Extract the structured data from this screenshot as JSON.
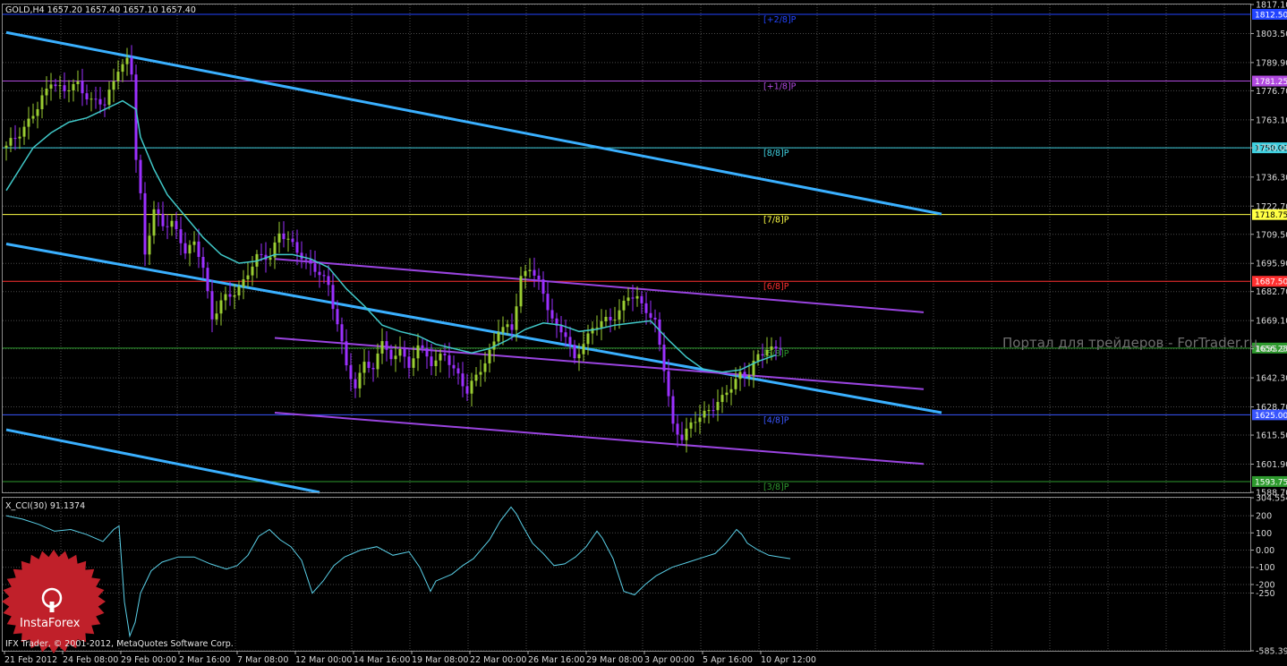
{
  "header": {
    "symbol_line": "GOLD,H4  1657.20 1657.40 1657.10 1657.40",
    "indicator_line": "X_CCI(30) 91.1374",
    "footer_text": "IFX Trader, © 2001-2012, MetaQuotes Software Corp.",
    "watermark": "Портал для трейдеров - ForTrader.ru",
    "logo_text": "InstaForex"
  },
  "colors": {
    "background": "#000000",
    "grid": "#4a4a4a",
    "bull_candle": "#9acd32",
    "bear_candle": "#9b30ff",
    "moving_average": "#40c8c8",
    "trend_channel": "#3ab0ff",
    "inner_channel": "#9a44e0",
    "cci_line": "#5ad0e8",
    "logo": "#c0202a"
  },
  "chart_data": [
    {
      "type": "candlestick",
      "symbol": "GOLD",
      "timeframe": "H4",
      "ylim": [
        1588.7,
        1817.1
      ],
      "y_ticks": [
        "1817.10",
        "1803.50",
        "1789.90",
        "1776.70",
        "1763.10",
        "1750.00",
        "1736.30",
        "1722.70",
        "1709.50",
        "1695.90",
        "1682.70",
        "1669.10",
        "1655.90",
        "1642.30",
        "1628.70",
        "1615.50",
        "1601.90",
        "1588.70"
      ],
      "x_labels": [
        "21 Feb 2012",
        "24 Feb 08:00",
        "29 Feb 00:00",
        "2 Mar 16:00",
        "7 Mar 08:00",
        "12 Mar 00:00",
        "14 Mar 16:00",
        "19 Mar 08:00",
        "22 Mar 00:00",
        "26 Mar 16:00",
        "29 Mar 08:00",
        "3 Apr 00:00",
        "5 Apr 16:00",
        "10 Apr 12:00"
      ],
      "price_path": [
        [
          0,
          1750
        ],
        [
          4,
          1760
        ],
        [
          7,
          1768
        ],
        [
          10,
          1782
        ],
        [
          13,
          1776
        ],
        [
          16,
          1780
        ],
        [
          19,
          1772
        ],
        [
          22,
          1770
        ],
        [
          25,
          1788
        ],
        [
          27,
          1790
        ],
        [
          28,
          1784
        ],
        [
          29,
          1745
        ],
        [
          30,
          1728
        ],
        [
          31,
          1700
        ],
        [
          33,
          1722
        ],
        [
          35,
          1712
        ],
        [
          37,
          1716
        ],
        [
          40,
          1702
        ],
        [
          42,
          1704
        ],
        [
          44,
          1695
        ],
        [
          46,
          1670
        ],
        [
          48,
          1678
        ],
        [
          50,
          1680
        ],
        [
          53,
          1688
        ],
        [
          56,
          1698
        ],
        [
          59,
          1700
        ],
        [
          61,
          1710
        ],
        [
          63,
          1706
        ],
        [
          66,
          1700
        ],
        [
          68,
          1695
        ],
        [
          70,
          1690
        ],
        [
          72,
          1686
        ],
        [
          74,
          1668
        ],
        [
          76,
          1648
        ],
        [
          78,
          1636
        ],
        [
          80,
          1652
        ],
        [
          82,
          1645
        ],
        [
          84,
          1660
        ],
        [
          86,
          1650
        ],
        [
          88,
          1658
        ],
        [
          90,
          1645
        ],
        [
          92,
          1658
        ],
        [
          95,
          1650
        ],
        [
          98,
          1652
        ],
        [
          101,
          1644
        ],
        [
          103,
          1636
        ],
        [
          105,
          1642
        ],
        [
          107,
          1650
        ],
        [
          110,
          1665
        ],
        [
          113,
          1665
        ],
        [
          115,
          1690
        ],
        [
          117,
          1694
        ],
        [
          119,
          1686
        ],
        [
          121,
          1676
        ],
        [
          123,
          1666
        ],
        [
          125,
          1662
        ],
        [
          127,
          1650
        ],
        [
          129,
          1660
        ],
        [
          131,
          1665
        ],
        [
          133,
          1668
        ],
        [
          135,
          1670
        ],
        [
          137,
          1674
        ],
        [
          139,
          1680
        ],
        [
          141,
          1679
        ],
        [
          143,
          1675
        ],
        [
          145,
          1668
        ],
        [
          147,
          1646
        ],
        [
          149,
          1620
        ],
        [
          151,
          1615
        ],
        [
          154,
          1622
        ],
        [
          157,
          1628
        ],
        [
          160,
          1632
        ],
        [
          162,
          1638
        ],
        [
          164,
          1645
        ],
        [
          166,
          1644
        ],
        [
          168,
          1652
        ],
        [
          170,
          1656
        ],
        [
          172,
          1657
        ],
        [
          173,
          1657
        ]
      ],
      "moving_average": [
        [
          0,
          1730
        ],
        [
          3,
          1740
        ],
        [
          6,
          1750
        ],
        [
          10,
          1757
        ],
        [
          14,
          1762
        ],
        [
          18,
          1764
        ],
        [
          22,
          1768
        ],
        [
          26,
          1772
        ],
        [
          29,
          1768
        ],
        [
          30,
          1755
        ],
        [
          33,
          1740
        ],
        [
          36,
          1728
        ],
        [
          40,
          1718
        ],
        [
          44,
          1708
        ],
        [
          48,
          1700
        ],
        [
          52,
          1696
        ],
        [
          56,
          1697
        ],
        [
          60,
          1700
        ],
        [
          64,
          1700
        ],
        [
          68,
          1698
        ],
        [
          72,
          1694
        ],
        [
          76,
          1684
        ],
        [
          80,
          1676
        ],
        [
          84,
          1667
        ],
        [
          88,
          1664
        ],
        [
          92,
          1662
        ],
        [
          96,
          1658
        ],
        [
          100,
          1656
        ],
        [
          104,
          1654
        ],
        [
          108,
          1656
        ],
        [
          112,
          1660
        ],
        [
          116,
          1665
        ],
        [
          120,
          1668
        ],
        [
          124,
          1667
        ],
        [
          128,
          1664
        ],
        [
          132,
          1665
        ],
        [
          136,
          1667
        ],
        [
          140,
          1668
        ],
        [
          144,
          1669
        ],
        [
          148,
          1660
        ],
        [
          152,
          1652
        ],
        [
          156,
          1646
        ],
        [
          160,
          1645
        ],
        [
          164,
          1646
        ],
        [
          168,
          1650
        ],
        [
          172,
          1653
        ]
      ],
      "levels": [
        {
          "label": "[+2/8]P",
          "price_tag": "1812.50",
          "value": 1812.5,
          "color": "#2244ff"
        },
        {
          "label": "[+1/8]P",
          "price_tag": "1781.25",
          "value": 1781.25,
          "color": "#b14ae0"
        },
        {
          "label": "[8/8]P",
          "price_tag": "1750.00",
          "value": 1750.0,
          "color": "#40d0e0"
        },
        {
          "label": "[7/8]P",
          "price_tag": "1718.75",
          "value": 1718.75,
          "color": "#ffff44"
        },
        {
          "label": "[6/8]P",
          "price_tag": "1687.50",
          "value": 1687.5,
          "color": "#ff3030"
        },
        {
          "label": "[5/8]P",
          "price_tag": "1656.25",
          "value": 1656.25,
          "color": "#2e9a2e"
        },
        {
          "label": "[4/8]P",
          "price_tag": "1625.00",
          "value": 1625.0,
          "color": "#3a56ff"
        },
        {
          "label": "[3/8]P",
          "price_tag": "1593.75",
          "value": 1593.75,
          "color": "#2e9a2e"
        }
      ],
      "trend_lines": [
        {
          "kind": "channel",
          "from": [
            0,
            1804
          ],
          "to": [
            209,
            1719
          ]
        },
        {
          "kind": "channel",
          "from": [
            0,
            1705
          ],
          "to": [
            209,
            1626
          ]
        },
        {
          "kind": "channel",
          "from": [
            0,
            1618
          ],
          "to": [
            70,
            1588.7
          ]
        },
        {
          "kind": "inner",
          "from": [
            60,
            1698
          ],
          "to": [
            205,
            1673
          ]
        },
        {
          "kind": "inner",
          "from": [
            60,
            1661
          ],
          "to": [
            205,
            1637
          ]
        },
        {
          "kind": "inner",
          "from": [
            60,
            1626
          ],
          "to": [
            205,
            1602
          ]
        }
      ]
    },
    {
      "type": "line",
      "name": "X_CCI(30)",
      "ylim": [
        -585.3956,
        304.5542
      ],
      "y_ticks": [
        "304.5542",
        "200",
        "100",
        "0.00",
        "-100",
        "-200",
        "-250",
        "-585.3956"
      ],
      "y_values": [
        304.5542,
        200,
        100,
        0,
        -100,
        -200,
        -250,
        -585.3956
      ],
      "points": [
        [
          0,
          200
        ],
        [
          3,
          180
        ],
        [
          6,
          150
        ],
        [
          9,
          110
        ],
        [
          12,
          120
        ],
        [
          15,
          90
        ],
        [
          18,
          50
        ],
        [
          20,
          120
        ],
        [
          21,
          140
        ],
        [
          22,
          -300
        ],
        [
          23,
          -500
        ],
        [
          24,
          -420
        ],
        [
          25,
          -250
        ],
        [
          27,
          -120
        ],
        [
          29,
          -70
        ],
        [
          32,
          -40
        ],
        [
          35,
          -40
        ],
        [
          38,
          -80
        ],
        [
          41,
          -110
        ],
        [
          43,
          -90
        ],
        [
          45,
          -30
        ],
        [
          47,
          80
        ],
        [
          49,
          120
        ],
        [
          51,
          60
        ],
        [
          53,
          20
        ],
        [
          55,
          -60
        ],
        [
          57,
          -250
        ],
        [
          59,
          -180
        ],
        [
          61,
          -90
        ],
        [
          63,
          -40
        ],
        [
          66,
          0
        ],
        [
          69,
          20
        ],
        [
          72,
          -30
        ],
        [
          75,
          -10
        ],
        [
          77,
          -100
        ],
        [
          79,
          -240
        ],
        [
          80,
          -180
        ],
        [
          83,
          -140
        ],
        [
          85,
          -90
        ],
        [
          87,
          -50
        ],
        [
          90,
          60
        ],
        [
          92,
          170
        ],
        [
          94,
          250
        ],
        [
          95,
          210
        ],
        [
          96,
          150
        ],
        [
          98,
          40
        ],
        [
          100,
          -20
        ],
        [
          102,
          -90
        ],
        [
          104,
          -80
        ],
        [
          106,
          -40
        ],
        [
          108,
          20
        ],
        [
          110,
          110
        ],
        [
          111,
          70
        ],
        [
          113,
          -50
        ],
        [
          115,
          -240
        ],
        [
          117,
          -260
        ],
        [
          119,
          -200
        ],
        [
          121,
          -150
        ],
        [
          124,
          -100
        ],
        [
          127,
          -70
        ],
        [
          130,
          -40
        ],
        [
          132,
          -20
        ],
        [
          134,
          40
        ],
        [
          136,
          120
        ],
        [
          137,
          90
        ],
        [
          138,
          40
        ],
        [
          140,
          0
        ],
        [
          142,
          -30
        ],
        [
          144,
          -40
        ],
        [
          146,
          -50
        ]
      ]
    }
  ]
}
